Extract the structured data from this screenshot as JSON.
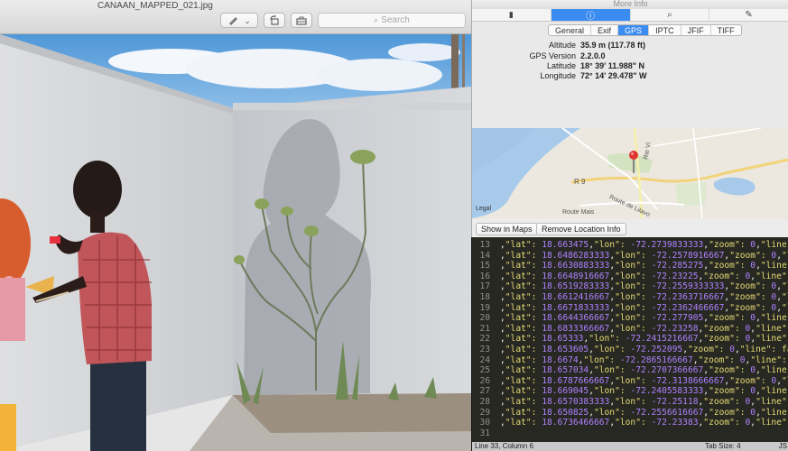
{
  "preview": {
    "file_name": "CANAAN_MAPPED_021.jpg",
    "search_placeholder": "Search",
    "markup_icon": "pen-icon",
    "chevron": "⌄"
  },
  "inspector": {
    "title": "More Info",
    "tabs": [
      {
        "icon": "document-icon",
        "glyph": "▮"
      },
      {
        "icon": "info-icon",
        "glyph": "ⓘ"
      },
      {
        "icon": "magnifier-icon",
        "glyph": "⌕"
      },
      {
        "icon": "pencil-icon",
        "glyph": "✎"
      }
    ],
    "segments": [
      "General",
      "Exif",
      "GPS",
      "IPTC",
      "JFIF",
      "TIFF"
    ],
    "active_segment": "GPS",
    "gps": [
      {
        "label": "Altitude",
        "value": "35.9 m (117.78 ft)"
      },
      {
        "label": "GPS Version",
        "value": "2.2.0.0"
      },
      {
        "label": "Latitude",
        "value": "18° 39' 11.988\" N"
      },
      {
        "label": "Longitude",
        "value": "72° 14' 29.478\" W"
      }
    ],
    "map": {
      "legal": "Legal",
      "road_r9": "R 9",
      "road_lilavois": "Route de Lilavo",
      "road_mais": "Route Mais",
      "road_vertical": "Rte Vi"
    },
    "buttons": {
      "show_in_maps": "Show in Maps",
      "remove_location": "Remove Location Info"
    }
  },
  "editor": {
    "lines": [
      {
        "n": "13",
        "lat": "18.663475",
        "lon": "-72.2739833333",
        "tail": "\"line\":"
      },
      {
        "n": "14",
        "lat": "18.6486283333",
        "lon": "-72.2578916667",
        "tail": "\"lin"
      },
      {
        "n": "15",
        "lat": "18.6630883333",
        "lon": "-72.285275",
        "tail": "\"line\":"
      },
      {
        "n": "16",
        "lat": "18.6648916667",
        "lon": "-72.23225",
        "tail": "\"line\": f"
      },
      {
        "n": "17",
        "lat": "18.6519283333",
        "lon": "-72.2559333333",
        "tail": "\"lin"
      },
      {
        "n": "18",
        "lat": "18.6612416667",
        "lon": "-72.2363716667",
        "tail": "\"lin"
      },
      {
        "n": "19",
        "lat": "18.6671833333",
        "lon": "-72.2362466667",
        "tail": "\"lin"
      },
      {
        "n": "20",
        "lat": "18.6644366667",
        "lon": "-72.277905",
        "tail": "\"line\":"
      },
      {
        "n": "21",
        "lat": "18.6833366667",
        "lon": "-72.23258",
        "tail": "\"line\": f"
      },
      {
        "n": "22",
        "lat": "18.65333",
        "lon": "-72.2415216667",
        "tail": "\"line\":"
      },
      {
        "n": "23",
        "lat": "18.653605",
        "lon": "-72.252095",
        "tail": "\"line\": fals"
      },
      {
        "n": "24",
        "lat": "18.6674",
        "lon": "-72.2865166667",
        "tail": "\"line\": fa"
      },
      {
        "n": "25",
        "lat": "18.657034",
        "lon": "-72.2707366667",
        "tail": "\"line\":"
      },
      {
        "n": "26",
        "lat": "18.6787666667",
        "lon": "-72.3138666667",
        "tail": "\"lin"
      },
      {
        "n": "27",
        "lat": "18.669045",
        "lon": "-72.2405583333",
        "tail": "\"line\":"
      },
      {
        "n": "28",
        "lat": "18.6570383333",
        "lon": "-72.25118",
        "tail": "\"line\": f"
      },
      {
        "n": "29",
        "lat": "18.650825",
        "lon": "-72.2556616667",
        "tail": "\"line\":"
      },
      {
        "n": "30",
        "lat": "18.6736466667",
        "lon": "-72.23383",
        "tail": "\"line\": f"
      },
      {
        "n": "31",
        "lat": "",
        "lon": "",
        "tail": ""
      }
    ],
    "key_lat": "\"lat\":",
    "key_lon": "\"lon\":",
    "key_zoom": "\"zoom\":",
    "zoom_value": "0",
    "status_position": "Line 33, Column 6",
    "status_tab": "Tab Size: 4",
    "status_syntax": "JS"
  }
}
